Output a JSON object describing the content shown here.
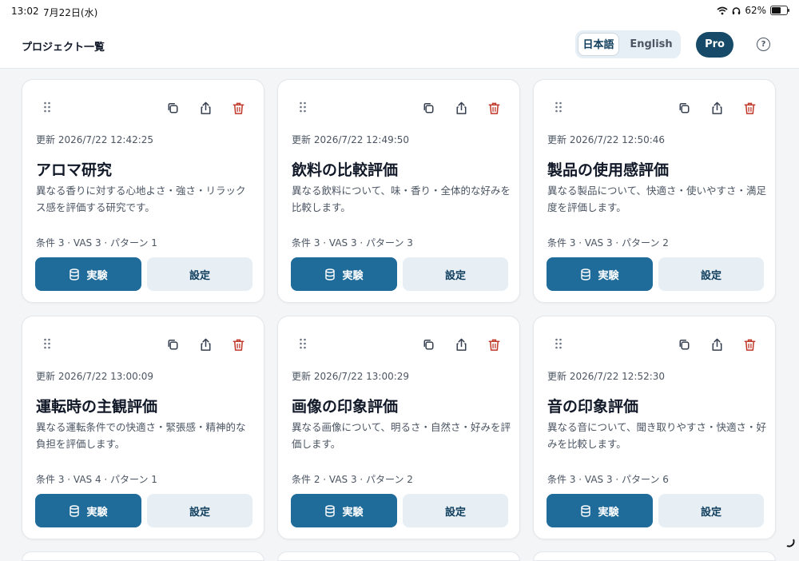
{
  "status_bar": {
    "time": "13:02",
    "date": "7月22日(水)",
    "battery_percent": "62%",
    "battery_level": 0.62
  },
  "header": {
    "title": "プロジェクト一覧",
    "lang_ja": "日本語",
    "lang_en": "English",
    "selected_language": "日本語",
    "pro_label": "Pro",
    "help_label": "?"
  },
  "colors": {
    "primary": "#1f6b99",
    "pro": "#174a69",
    "delete": "#c0392b",
    "secondary_button": "#e7eff5"
  },
  "icons": [
    "drag-handle-icon",
    "copy-icon",
    "share-icon",
    "trash-icon",
    "database-icon",
    "help-icon",
    "wifi-icon",
    "headphones-icon",
    "battery-icon"
  ],
  "cards": [
    {
      "updated": "更新 2026/7/22 12:42:25",
      "title": "アロマ研究",
      "description": "異なる香りに対する心地よさ・強さ・リラックス感を評価する研究です。",
      "meta": "条件 3 · VAS 3 · パターン 1",
      "run_label": "実験",
      "settings_label": "設定"
    },
    {
      "updated": "更新 2026/7/22 12:49:50",
      "title": "飲料の比較評価",
      "description": "異なる飲料について、味・香り・全体的な好みを比較します。",
      "meta": "条件 3 · VAS 3 · パターン 3",
      "run_label": "実験",
      "settings_label": "設定"
    },
    {
      "updated": "更新 2026/7/22 12:50:46",
      "title": "製品の使用感評価",
      "description": "異なる製品について、快適さ・使いやすさ・満足度を評価します。",
      "meta": "条件 3 · VAS 3 · パターン 2",
      "run_label": "実験",
      "settings_label": "設定"
    },
    {
      "updated": "更新 2026/7/22 13:00:09",
      "title": "運転時の主観評価",
      "description": "異なる運転条件での快適さ・緊張感・精神的な負担を評価します。",
      "meta": "条件 3 · VAS 4 · パターン 1",
      "run_label": "実験",
      "settings_label": "設定"
    },
    {
      "updated": "更新 2026/7/22 13:00:29",
      "title": "画像の印象評価",
      "description": "異なる画像について、明るさ・自然さ・好みを評価します。",
      "meta": "条件 2 · VAS 3 · パターン 2",
      "run_label": "実験",
      "settings_label": "設定"
    },
    {
      "updated": "更新 2026/7/22 12:52:30",
      "title": "音の印象評価",
      "description": "異なる音について、聞き取りやすさ・快適さ・好みを比較します。",
      "meta": "条件 3 · VAS 3 · パターン 6",
      "run_label": "実験",
      "settings_label": "設定"
    }
  ]
}
